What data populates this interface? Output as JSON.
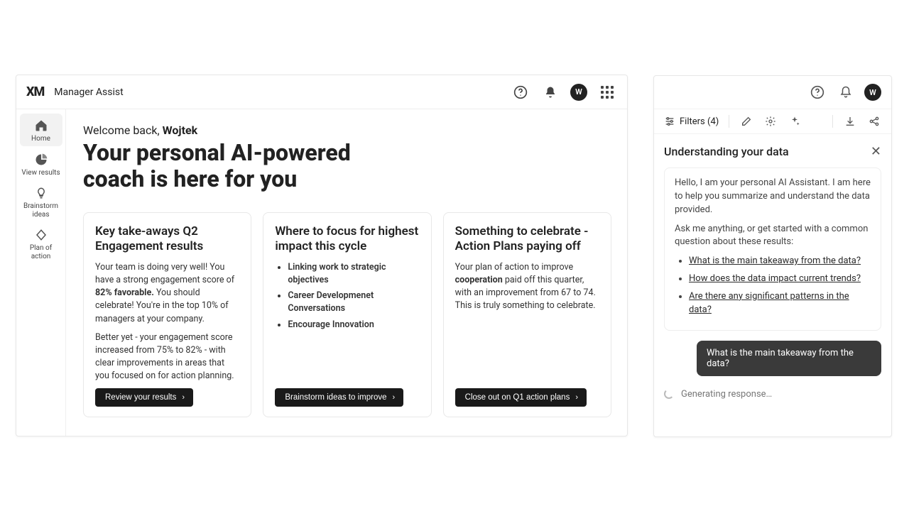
{
  "header": {
    "logo": "XM",
    "app_title": "Manager Assist",
    "avatar_initial": "W"
  },
  "sidebar": {
    "items": [
      {
        "label": "Home"
      },
      {
        "label": "View results"
      },
      {
        "label": "Brainstorm ideas"
      },
      {
        "label": "Plan of action"
      }
    ]
  },
  "main": {
    "welcome_prefix": "Welcome back, ",
    "welcome_name": "Wojtek",
    "hero": "Your personal AI-powered coach is here for you"
  },
  "cards": [
    {
      "title": "Key take-aways Q2 Engagement results",
      "p1a": "Your team is doing very well!  You have a strong engagement score of ",
      "p1b": "82% favorable.",
      "p1c": " You should celebrate!  You're in the top 10% of managers at your company.",
      "p2": "Better yet - your engagement score increased from 75% to 82% - with clear improvements in areas that you focused on for action planning.",
      "button": "Review your results"
    },
    {
      "title": "Where to focus for highest impact this cycle",
      "bullets": [
        "Linking work to strategic objectives",
        "Career Developmenet Conversations",
        "Encourage Innovation"
      ],
      "button": "Brainstorm ideas to improve"
    },
    {
      "title": "Something to celebrate - Action Plans paying off",
      "p1a": "Your plan of action to improve ",
      "p1b": "cooperation",
      "p1c": " paid off this quarter, with an improvement from 67 to 74. This is truly something to celebrate.",
      "button": "Close out on Q1 action plans"
    }
  ],
  "panel": {
    "avatar_initial": "W",
    "filters_label": "Filters (4)",
    "section_title": "Understanding your data",
    "intro1": "Hello, I am your personal AI Assistant. I am here to help you summarize and understand the data provided.",
    "intro2": "Ask me anything, or get started with a common question about these results:",
    "questions": [
      "What is the main takeaway from the data?",
      "How does the data impact current trends?",
      "Are there any significant patterns in the data?"
    ],
    "user_question": "What is the main takeaway from the data?",
    "generating": "Generating response…"
  }
}
